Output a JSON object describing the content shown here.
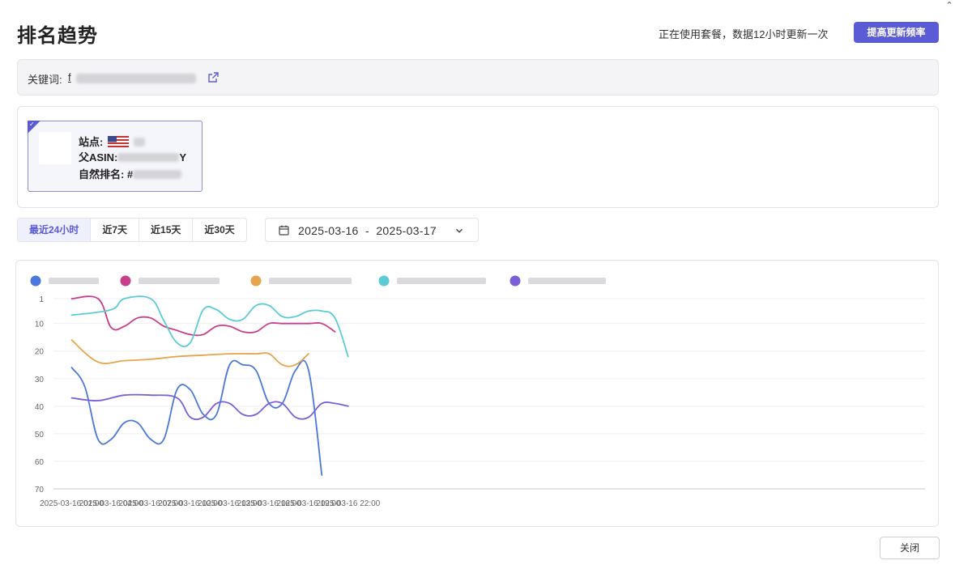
{
  "page": {
    "title": "排名趋势",
    "plan_text": "正在使用套餐，数据12小时更新一次",
    "upgrade_label": "提高更新频率",
    "close_label": "关闭"
  },
  "keyword": {
    "label": "关键词:",
    "value_visible": "f"
  },
  "product": {
    "site_label": "站点:",
    "asin_label": "父ASIN:",
    "asin_suffix": "Y",
    "rank_label": "自然排名: #"
  },
  "time_ranges": [
    "最近24小时",
    "近7天",
    "近15天",
    "近30天"
  ],
  "active_range": 0,
  "date_range": "2025-03-16  -  2025-03-17",
  "colors": {
    "accent": "#5b5bd6",
    "series": [
      "#4a78dc",
      "#c93d8a",
      "#e8a44c",
      "#5ccbd6",
      "#7b5fd9"
    ]
  },
  "chart_data": {
    "type": "line",
    "x": [
      "2025-03-16 01:00",
      "2025-03-16 04:00",
      "2025-03-16 07:00",
      "2025-03-16 10:00",
      "2025-03-16 13:00",
      "2025-03-16 16:00",
      "2025-03-16 19:00",
      "2025-03-16 22:00"
    ],
    "ylim": [
      1,
      70
    ],
    "y_reversed": true,
    "yticks": [
      1,
      10,
      20,
      30,
      40,
      50,
      60,
      70
    ],
    "grid": true,
    "legend_position": "top-left",
    "series": [
      {
        "values": [
          [
            1,
            26
          ],
          [
            2,
            33
          ],
          [
            3,
            52
          ],
          [
            4,
            52
          ],
          [
            5,
            46
          ],
          [
            6,
            46
          ],
          [
            7,
            52
          ],
          [
            8,
            52
          ],
          [
            9,
            34
          ],
          [
            10,
            34
          ],
          [
            11,
            43
          ],
          [
            12,
            43
          ],
          [
            13,
            25
          ],
          [
            14,
            25
          ],
          [
            15,
            27
          ],
          [
            16,
            39
          ],
          [
            17,
            39
          ],
          [
            18,
            27
          ],
          [
            19,
            27
          ],
          [
            20,
            65
          ]
        ]
      },
      {
        "values": [
          [
            1,
            1
          ],
          [
            3,
            1
          ],
          [
            4,
            11.5
          ],
          [
            5,
            11
          ],
          [
            6,
            8
          ],
          [
            7,
            8
          ],
          [
            8,
            11
          ],
          [
            9,
            12.5
          ],
          [
            10,
            14
          ],
          [
            11,
            14
          ],
          [
            12,
            11
          ],
          [
            13,
            11
          ],
          [
            14,
            13
          ],
          [
            15,
            13
          ],
          [
            16,
            10
          ],
          [
            17,
            10
          ],
          [
            19,
            10
          ],
          [
            20,
            10
          ],
          [
            21,
            13
          ]
        ]
      },
      {
        "values": [
          [
            1,
            16
          ],
          [
            3,
            24
          ],
          [
            5,
            23.5
          ],
          [
            7,
            23
          ],
          [
            9,
            22
          ],
          [
            11,
            21.5
          ],
          [
            13,
            21
          ],
          [
            15,
            21
          ],
          [
            16,
            21
          ],
          [
            17,
            25
          ],
          [
            18,
            25
          ],
          [
            19,
            21
          ]
        ]
      },
      {
        "values": [
          [
            1,
            7
          ],
          [
            4,
            5
          ],
          [
            5,
            1
          ],
          [
            7,
            1
          ],
          [
            8,
            9
          ],
          [
            9,
            17
          ],
          [
            10,
            17
          ],
          [
            11,
            5
          ],
          [
            12,
            5
          ],
          [
            13,
            8.5
          ],
          [
            14,
            8.5
          ],
          [
            15,
            3.5
          ],
          [
            16,
            3.5
          ],
          [
            17,
            7.5
          ],
          [
            18,
            7.5
          ],
          [
            19,
            5.5
          ],
          [
            20,
            5.5
          ],
          [
            21,
            8
          ],
          [
            22,
            22
          ]
        ]
      },
      {
        "values": [
          [
            1,
            37
          ],
          [
            3,
            38
          ],
          [
            5,
            36
          ],
          [
            7,
            36
          ],
          [
            9,
            37
          ],
          [
            10,
            44
          ],
          [
            11,
            44
          ],
          [
            12,
            39
          ],
          [
            13,
            39
          ],
          [
            14,
            43
          ],
          [
            15,
            43
          ],
          [
            16,
            39
          ],
          [
            17,
            39
          ],
          [
            18,
            44
          ],
          [
            19,
            44
          ],
          [
            20,
            39
          ],
          [
            21,
            39
          ],
          [
            22,
            40
          ]
        ]
      }
    ]
  }
}
